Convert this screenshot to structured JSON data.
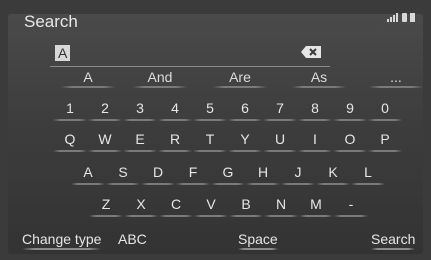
{
  "header": {
    "title": "Search"
  },
  "input": {
    "value": "A"
  },
  "predictions": [
    "A",
    "And",
    "Are",
    "As"
  ],
  "more_label": "...",
  "rows": {
    "numbers": [
      "1",
      "2",
      "3",
      "4",
      "5",
      "6",
      "7",
      "8",
      "9",
      "0"
    ],
    "row1": [
      "Q",
      "W",
      "E",
      "R",
      "T",
      "Y",
      "U",
      "I",
      "O",
      "P"
    ],
    "row2": [
      "A",
      "S",
      "D",
      "F",
      "G",
      "H",
      "J",
      "K",
      "L"
    ],
    "row3": [
      "Z",
      "X",
      "C",
      "V",
      "B",
      "N",
      "M",
      "-"
    ]
  },
  "bottom": {
    "change_type": "Change type",
    "mode": "ABC",
    "space": "Space",
    "search": "Search"
  }
}
